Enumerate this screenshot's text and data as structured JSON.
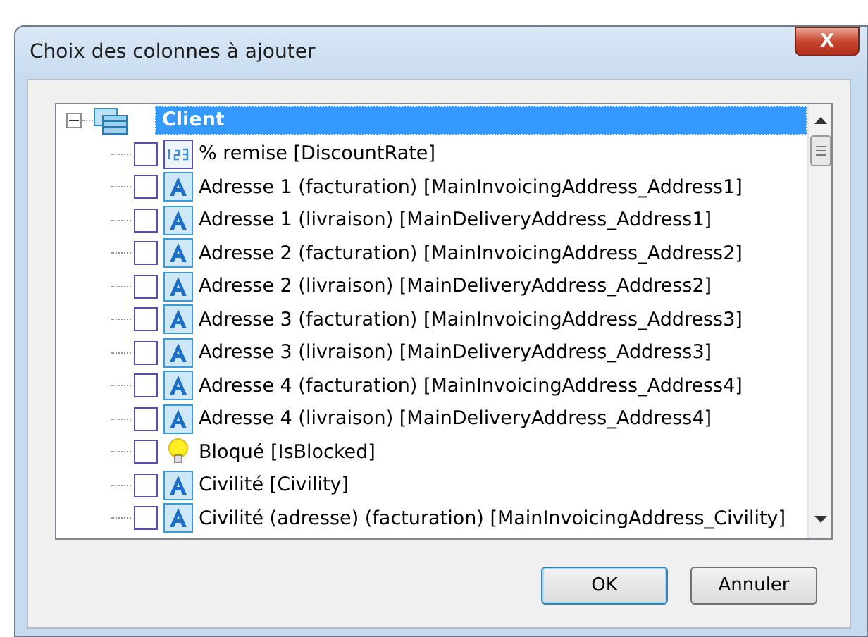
{
  "window": {
    "title": "Choix des colonnes à ajouter",
    "close_label": "X"
  },
  "tree": {
    "label": "Client",
    "selected": true,
    "expanded": true,
    "children": [
      {
        "kind": "number",
        "label": "% remise [DiscountRate]",
        "checked": false
      },
      {
        "kind": "text",
        "label": "Adresse 1 (facturation) [MainInvoicingAddress_Address1]",
        "checked": false
      },
      {
        "kind": "text",
        "label": "Adresse 1 (livraison) [MainDeliveryAddress_Address1]",
        "checked": false
      },
      {
        "kind": "text",
        "label": "Adresse 2 (facturation) [MainInvoicingAddress_Address2]",
        "checked": false
      },
      {
        "kind": "text",
        "label": "Adresse 2 (livraison) [MainDeliveryAddress_Address2]",
        "checked": false
      },
      {
        "kind": "text",
        "label": "Adresse 3 (facturation) [MainInvoicingAddress_Address3]",
        "checked": false
      },
      {
        "kind": "text",
        "label": "Adresse 3 (livraison) [MainDeliveryAddress_Address3]",
        "checked": false
      },
      {
        "kind": "text",
        "label": "Adresse 4 (facturation) [MainInvoicingAddress_Address4]",
        "checked": false
      },
      {
        "kind": "text",
        "label": "Adresse 4 (livraison) [MainDeliveryAddress_Address4]",
        "checked": false
      },
      {
        "kind": "bool",
        "label": "Bloqué [IsBlocked]",
        "checked": false
      },
      {
        "kind": "text",
        "label": "Civilité [Civility]",
        "checked": false
      },
      {
        "kind": "text",
        "label": "Civilité (adresse) (facturation) [MainInvoicingAddress_Civility]",
        "checked": false
      }
    ]
  },
  "buttons": [
    {
      "label": "OK",
      "default": true
    },
    {
      "label": "Annuler",
      "default": false
    }
  ]
}
